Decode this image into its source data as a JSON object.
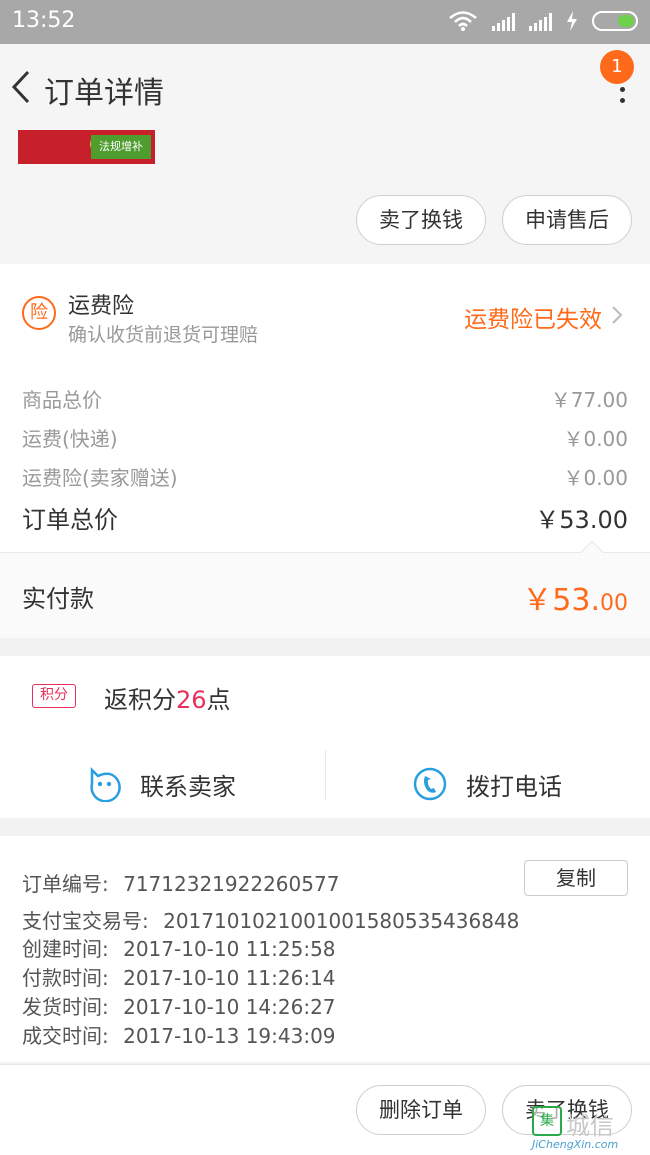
{
  "status_bar": {
    "time": "13:52"
  },
  "header": {
    "title": "订单详情",
    "badge_count": "1"
  },
  "product": {
    "thumb_text": "法规增补"
  },
  "top_actions": {
    "sell_label": "卖了换钱",
    "after_sale_label": "申请售后"
  },
  "insurance": {
    "icon_text": "险",
    "title": "运费险",
    "subtitle": "确认收货前退货可理赔",
    "status": "运费险已失效"
  },
  "prices": [
    {
      "label": "商品总价",
      "value": "￥77.00"
    },
    {
      "label": "运费(快递)",
      "value": "￥0.00"
    },
    {
      "label": "运费险(卖家赠送)",
      "value": "￥0.00"
    }
  ],
  "order_total": {
    "label": "订单总价",
    "value": "￥53.00"
  },
  "paid": {
    "label": "实付款",
    "value_main": "￥53.",
    "value_cents": "00"
  },
  "points": {
    "tag": "积分",
    "prefix": "返积分",
    "number": "26",
    "suffix": "点"
  },
  "contact": {
    "seller_label": "联系卖家",
    "call_label": "拨打电话"
  },
  "order_info": {
    "copy_label": "复制",
    "lines": [
      {
        "label": "订单编号: ",
        "value": "71712321922260577"
      },
      {
        "label": "支付宝交易号: ",
        "value": "2017101021001001580535436848"
      },
      {
        "label": "创建时间: ",
        "value": "2017-10-10 11:25:58"
      },
      {
        "label": "付款时间: ",
        "value": "2017-10-10 11:26:14"
      },
      {
        "label": "发货时间: ",
        "value": "2017-10-10 14:26:27"
      },
      {
        "label": "成交时间: ",
        "value": "2017-10-13 19:43:09"
      }
    ]
  },
  "bottom_actions": {
    "delete_label": "删除订单",
    "sell_label": "卖了换钱"
  },
  "watermark": {
    "logo": "集",
    "text": "城信",
    "url": "JiChengXin.com"
  },
  "colors": {
    "accent": "#ff6a1a",
    "points": "#e8305a",
    "icon_blue": "#2a9fe0",
    "statusbar": "#a8a8a8"
  }
}
